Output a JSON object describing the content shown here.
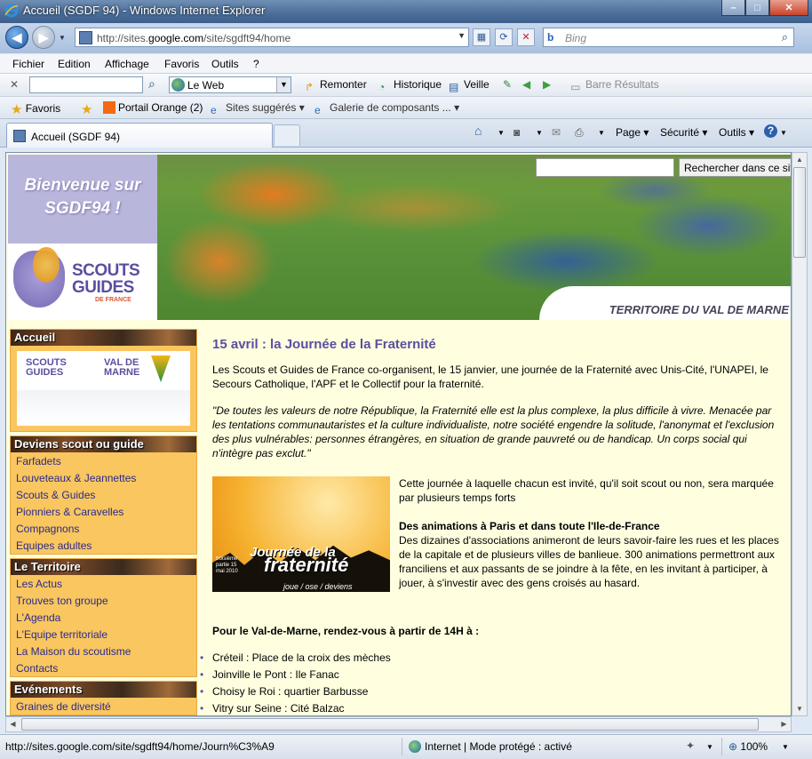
{
  "window": {
    "title": "Accueil (SGDF 94) - Windows Internet Explorer",
    "minimize": "–",
    "maximize": "□",
    "close": "✕"
  },
  "address": {
    "url_prefix": "http://sites.",
    "url_domain": "google.com",
    "url_path": "/site/sgdft94/home",
    "search_placeholder": "Bing"
  },
  "menu": [
    "Fichier",
    "Edition",
    "Affichage",
    "Favoris",
    "Outils",
    "?"
  ],
  "toolbar": {
    "search_engine": "Le Web",
    "remonter": "Remonter",
    "historique": "Historique",
    "veille": "Veille",
    "barre_resultats": "Barre Résultats"
  },
  "favorites": {
    "favoris": "Favoris",
    "portail": "Portail Orange (2)",
    "sites": "Sites suggérés ▾",
    "galerie": "Galerie de composants ... ▾"
  },
  "tabs": {
    "active": "Accueil (SGDF 94)",
    "page": "Page ▾",
    "securite": "Sécurité ▾",
    "outils": "Outils ▾"
  },
  "site": {
    "welcome_line1": "Bienvenue sur",
    "welcome_line2": "SGDF94 !",
    "logo_line1": "SCOUTS",
    "logo_line2": "GUIDES",
    "logo_line3": "DE FRANCE",
    "territoire": "TERRITOIRE DU VAL DE MARNE",
    "search_button": "Rechercher dans ce site",
    "vdm_logo_left": "SCOUTS GUIDES",
    "vdm_logo_right": "VAL DE MARNE"
  },
  "sidebar": [
    {
      "title": "Accueil",
      "items": []
    },
    {
      "title": "Deviens scout ou guide",
      "items": [
        "Farfadets",
        "Louveteaux & Jeannettes",
        "Scouts & Guides",
        "Pionniers & Caravelles",
        "Compagnons",
        "Equipes adultes"
      ]
    },
    {
      "title": "Le Territoire",
      "items": [
        "Les Actus",
        "Trouves ton groupe",
        "L'Agenda",
        "L'Equipe territoriale",
        "La Maison du scoutisme",
        "Contacts"
      ]
    },
    {
      "title": "Evénements",
      "items": [
        "Graines de diversité"
      ]
    }
  ],
  "article": {
    "title": "15 avril : la Journée de la Fraternité",
    "intro": "Les Scouts et Guides de France co-organisent, le 15 janvier, une journée de la Fraternité avec Unis-Cité, l'UNAPEI, le Secours Catholique, l'APF et le Collectif pour la fraternité.",
    "quote": "\"De toutes les valeurs de notre République, la Fraternité elle est la plus complexe, la plus difficile à vivre. Menacée par les tentations communautaristes et la culture individualiste, notre société engendre la solitude, l'anonymat et l'exclusion des plus vulnérables: personnes étrangères, en situation de grande pauvreté ou de handicap. Un corps social qui n'intègre pas exclut.\"",
    "para1": "Cette journée à laquelle chacun est invité, qu'il soit scout ou non, sera marquée par plusieurs temps forts",
    "subhead": "Des animations à Paris et dans toute l'Ile-de-France",
    "para2": "Des dizaines d'associations animeront de leurs savoir-faire les rues et les places de la capitale et de plusieurs villes de banlieue. 300 animations permettront aux franciliens et aux passants de se joindre à la fête, en les invitant à participer, à jouer, à s'investir avec des gens croisés au hasard.",
    "rdv": "Pour le Val-de-Marne, rendez-vous à partir de 14H à :",
    "places": [
      "Créteil : Place de la croix des mèches",
      "Joinville le Pont : Ile Fanac",
      "Choisy le Roi : quartier Barbusse",
      "Vitry sur Seine : Cité Balzac"
    ],
    "poster_line1": "Journée de la",
    "poster_line2": "fraternité",
    "poster_line3": "joue / ose / deviens",
    "poster_small": "troisième partie 15 mai 2010"
  },
  "status": {
    "url": "http://sites.google.com/site/sgdft94/home/Journ%C3%A9",
    "zone": "Internet | Mode protégé : activé",
    "zoom": "100%"
  }
}
